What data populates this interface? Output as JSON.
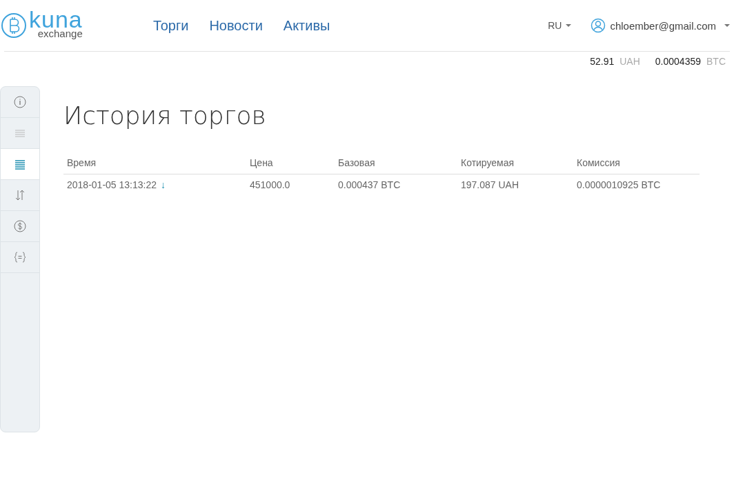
{
  "logo": {
    "name": "kuna",
    "sub": "exchange"
  },
  "nav": [
    "Торги",
    "Новости",
    "Активы"
  ],
  "language": "RU",
  "user": "chloember@gmail.com",
  "balances": [
    {
      "amount": "52.91",
      "currency": "UAH"
    },
    {
      "amount": "0.0004359",
      "currency": "BTC"
    }
  ],
  "sidebar": [
    {
      "kind": "info",
      "selected": false
    },
    {
      "kind": "lines",
      "selected": false
    },
    {
      "kind": "list",
      "selected": true
    },
    {
      "kind": "transfer",
      "selected": false
    },
    {
      "kind": "dollar",
      "selected": false
    },
    {
      "kind": "braces",
      "selected": false
    }
  ],
  "title": "История торгов",
  "table": {
    "columns": [
      "Время",
      "Цена",
      "Базовая",
      "Котируемая",
      "Комиссия"
    ],
    "rows": [
      {
        "direction": "↓",
        "cells": [
          "2018-01-05 13:13:22",
          "451000.0",
          "0.000437 BTC",
          "197.087 UAH",
          "0.0000010925 BTC"
        ]
      }
    ]
  }
}
